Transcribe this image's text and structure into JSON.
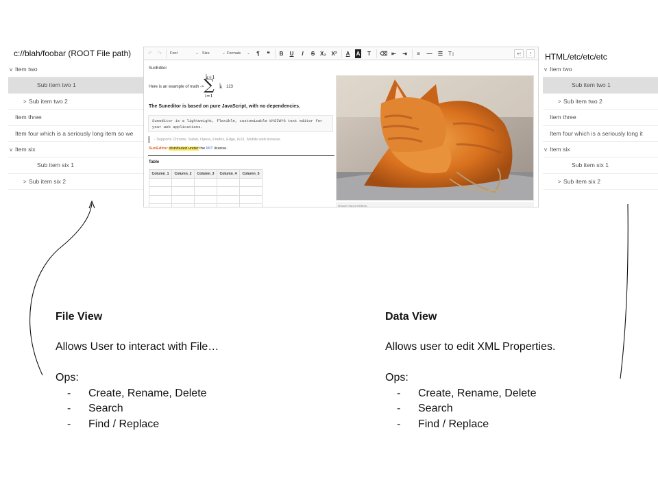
{
  "file_panel": {
    "path_label": "c://blah/foobar (ROOT File path)",
    "tree": [
      {
        "label": "Item two",
        "level": 0,
        "expander": "v"
      },
      {
        "label": "Sub item two 1",
        "level": 2,
        "expander": "",
        "selected": true
      },
      {
        "label": "Sub item two 2",
        "level": 1,
        "expander": ">"
      },
      {
        "label": "Item three",
        "level": 0,
        "expander": ""
      },
      {
        "label": "Item four which is a seriously long item so we",
        "level": 0,
        "expander": ""
      },
      {
        "label": "Item six",
        "level": 0,
        "expander": "v"
      },
      {
        "label": "Sub item six 1",
        "level": 2,
        "expander": ""
      },
      {
        "label": "Sub item six 2",
        "level": 1,
        "expander": ">"
      }
    ]
  },
  "data_panel": {
    "path_label": "HTML/etc/etc/etc",
    "tree": [
      {
        "label": "Item two",
        "level": 0,
        "expander": "v"
      },
      {
        "label": "Sub item two 1",
        "level": 2,
        "expander": "",
        "selected": true
      },
      {
        "label": "Sub item two 2",
        "level": 1,
        "expander": ">"
      },
      {
        "label": "Item three",
        "level": 0,
        "expander": ""
      },
      {
        "label": "Item four which is a seriously long it",
        "level": 0,
        "expander": ""
      },
      {
        "label": "Item six",
        "level": 0,
        "expander": "v"
      },
      {
        "label": "Sub item six 1",
        "level": 2,
        "expander": ""
      },
      {
        "label": "Sub item six 2",
        "level": 1,
        "expander": ">"
      }
    ]
  },
  "editor": {
    "toolbar": {
      "font_label": "Font",
      "size_label": "Size",
      "formats_label": "Formats"
    },
    "heading": "SunEditor",
    "math_prefix": "Here is an example of math ->",
    "math_upper": "k̄+1",
    "math_sigma": "∑",
    "math_lower": "i=1",
    "math_term": "k̄",
    "math_suffix": "123",
    "bold_line": "The Suneditor is based on pure JavaScript, with no dependencies.",
    "code_lines": [
      "Suneditor is a lightweight, flexible, customizable WYSIWYG text editor for",
      "your web applications."
    ],
    "quote": "- Supports Chrome, Safari, Opera, Firefox, Edge, IE11, Mobile web browser.",
    "license": {
      "name": "SunEditor",
      "middle": "distributed under",
      "the": "the",
      "mit": "MIT",
      "end": "license."
    },
    "table_title": "Table",
    "table_headers": [
      "Column_1",
      "Column_2",
      "Column_3",
      "Column_4",
      "Column_5"
    ],
    "image_caption": "Insert description"
  },
  "file_view": {
    "title": "File View",
    "description": "Allows User to interact with File…",
    "ops_title": "Ops:",
    "ops": [
      "Create, Rename, Delete",
      "Search",
      "Find / Replace"
    ]
  },
  "data_view": {
    "title": "Data View",
    "description": "Allows user to edit XML Properties.",
    "ops_title": "Ops:",
    "ops": [
      "Create, Rename, Delete",
      "Search",
      "Find / Replace"
    ]
  },
  "colors": {
    "selection": "#dedede",
    "cat_orange": "#d9711e",
    "license_name": "#e2632b",
    "highlight": "#f5ea63",
    "mit_link": "#3b6fd8"
  }
}
